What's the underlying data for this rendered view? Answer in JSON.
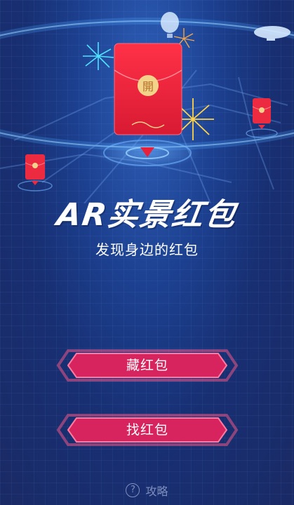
{
  "hero": {
    "title": "AR实景红包",
    "subtitle": "发现身边的红包"
  },
  "envelope": {
    "seal_char": "開"
  },
  "buttons": {
    "hide": "藏红包",
    "find": "找红包"
  },
  "guide": {
    "label": "攻略"
  },
  "colors": {
    "background": "#1c3f8e",
    "envelope_red": "#e8213a",
    "seal_gold": "#f3d28a",
    "button_pink": "#d8245e",
    "button_glow": "#ff5a8a"
  }
}
